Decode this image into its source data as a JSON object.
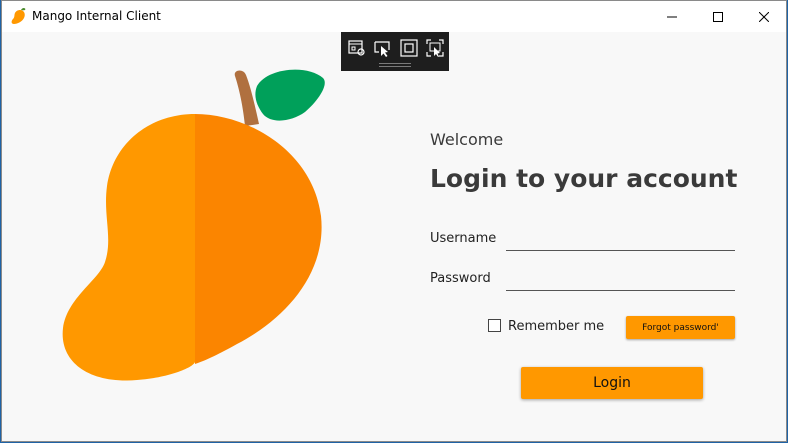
{
  "window": {
    "title": "Mango Internal Client"
  },
  "devtools": {
    "icons": [
      "select-element-icon",
      "pointer-select-icon",
      "layout-adorner-icon",
      "track-focus-icon"
    ]
  },
  "form": {
    "welcome": "Welcome",
    "heading": "Login to your account",
    "username_label": "Username",
    "username_value": "",
    "password_label": "Password",
    "password_value": "",
    "remember_label": "Remember me",
    "remember_checked": false,
    "forgot_label": "Forgot password'",
    "login_label": "Login"
  },
  "colors": {
    "accent": "#ff9800",
    "mango_light": "#ff9800",
    "mango_dark": "#fb8500",
    "leaf": "#00a05a",
    "stem": "#b0703f"
  }
}
